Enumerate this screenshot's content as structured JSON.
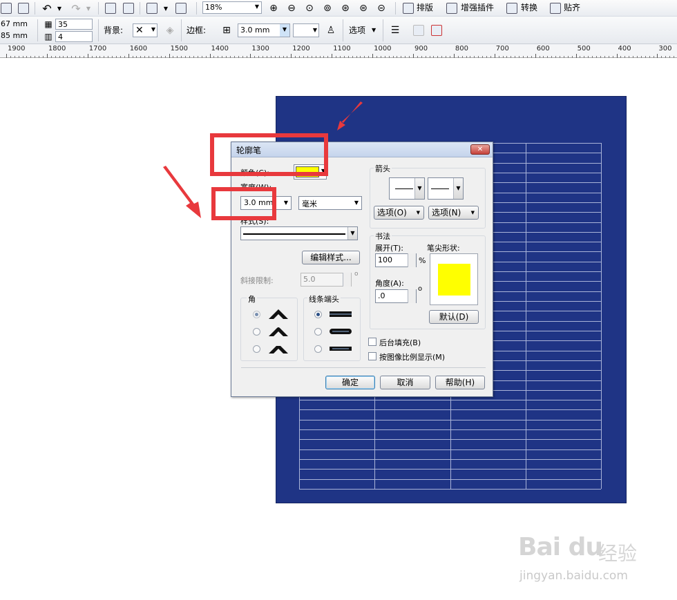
{
  "toolbar1": {
    "zoom": "18%",
    "layout_label": "排版",
    "plugins_label": "增强插件",
    "convert_label": "转换",
    "snap_label": "贴齐"
  },
  "toolbar2": {
    "width_value": "67 mm",
    "height_value": "85 mm",
    "rows_value": "35",
    "cols_value": "4",
    "background_label": "背景:",
    "border_label": "边框:",
    "border_width": "3.0 mm",
    "options_label": "选项"
  },
  "ruler": {
    "labels": [
      "1900",
      "1800",
      "1700",
      "1600",
      "1500",
      "1400",
      "1300",
      "1200",
      "1100",
      "1000",
      "900",
      "800",
      "700",
      "600",
      "500",
      "400",
      "300"
    ]
  },
  "dialog": {
    "title": "轮廓笔",
    "color_label": "颜色(C):",
    "color_value": "#ffff00",
    "width_label": "宽度(W):",
    "width_value": "3.0 mm",
    "unit_value": "毫米",
    "style_label": "样式(S):",
    "edit_style_button": "编辑样式...",
    "miter_label": "斜接限制:",
    "miter_value": "5.0",
    "corner_group": "角",
    "linecap_group": "线条端头",
    "arrows_group": "箭头",
    "options_left": "选项(O)",
    "options_right": "选项(N)",
    "calligraphy_group": "书法",
    "stretch_label": "展开(T):",
    "stretch_value": "100",
    "percent": "%",
    "angle_label": "角度(A):",
    "angle_value": ".0",
    "degree": "o",
    "nib_label": "笔尖形状:",
    "default_button": "默认(D)",
    "behind_fill": "后台填充(B)",
    "scale_with_image": "按图像比例显示(M)",
    "ok_button": "确定",
    "cancel_button": "取消",
    "help_button": "帮助(H)"
  },
  "watermark": {
    "brand": "Bai du",
    "brand_cn": "经验",
    "url": "jingyan.baidu.com"
  }
}
